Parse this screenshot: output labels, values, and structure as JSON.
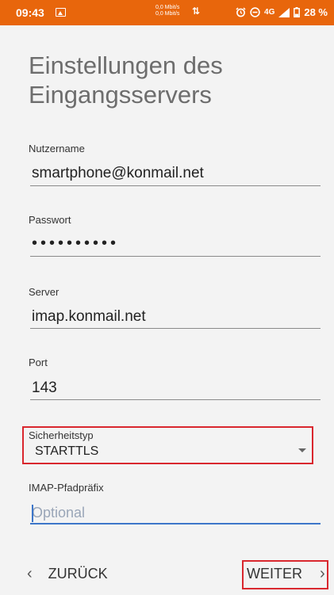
{
  "status_bar": {
    "time": "09:43",
    "net_up": "0,0 Mbit/s",
    "net_down": "0,0 Mbit/s",
    "network_type": "4G",
    "battery": "28 %"
  },
  "page_title": "Einstellungen des Eingangsservers",
  "fields": {
    "username": {
      "label": "Nutzername",
      "value": "smartphone@konmail.net"
    },
    "password": {
      "label": "Passwort",
      "value": "••••••••••"
    },
    "server": {
      "label": "Server",
      "value": "imap.konmail.net"
    },
    "port": {
      "label": "Port",
      "value": "143"
    },
    "security": {
      "label": "Sicherheitstyp",
      "value": "STARTTLS"
    },
    "imap_prefix": {
      "label": "IMAP-Pfadpräfix",
      "placeholder": "Optional",
      "value": ""
    }
  },
  "nav": {
    "back_label": "ZURÜCK",
    "next_label": "WEITER"
  },
  "colors": {
    "status_bar": "#e8660c",
    "background": "#f3f3f3",
    "highlight": "#d9272e",
    "focus": "#3d76c9"
  }
}
